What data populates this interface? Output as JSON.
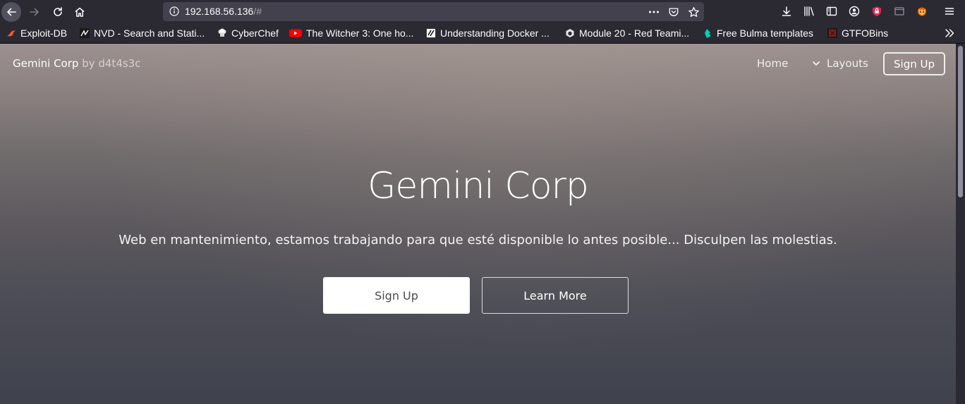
{
  "browser": {
    "url_host": "192.168.56.136",
    "url_path": "/#",
    "accent_private_icon": "#e22850"
  },
  "bookmarks": [
    {
      "label": "Exploit-DB",
      "icon": "exploitdb-icon",
      "color": "#f05a28"
    },
    {
      "label": "NVD - Search and Stati...",
      "icon": "nvd-icon",
      "color": "#ffffff"
    },
    {
      "label": "CyberChef",
      "icon": "cyberchef-icon",
      "color": "#dddddd"
    },
    {
      "label": "The Witcher 3: One ho...",
      "icon": "youtube-icon",
      "color": "#ff0000"
    },
    {
      "label": "Understanding Docker ...",
      "icon": "docker-book-icon",
      "color": "#ffffff"
    },
    {
      "label": "Module 20 - Red Teami...",
      "icon": "module-icon",
      "color": "#dddddd"
    },
    {
      "label": "Free Bulma templates",
      "icon": "bulma-icon",
      "color": "#00d1b2"
    },
    {
      "label": "GTFOBins",
      "icon": "gtfobins-icon",
      "color": "#8b1a1a"
    }
  ],
  "site": {
    "brand_name": "Gemini Corp",
    "brand_by": "by d4t4s3c",
    "nav": {
      "home": "Home",
      "layouts": "Layouts",
      "signup": "Sign Up"
    },
    "hero": {
      "title": "Gemini Corp",
      "subtitle": "Web en mantenimiento, estamos trabajando para que esté disponible lo antes posible... Disculpen las molestias.",
      "primary_button": "Sign Up",
      "secondary_button": "Learn More"
    }
  }
}
